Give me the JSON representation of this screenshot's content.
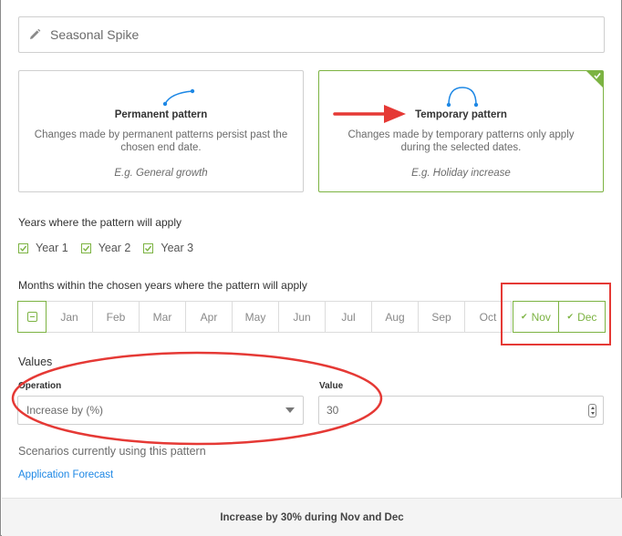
{
  "pattern_name": {
    "value": "Seasonal Spike",
    "icon": "pencil-icon"
  },
  "patterns": [
    {
      "title": "Permanent pattern",
      "description": "Changes made by permanent patterns persist past the chosen end date.",
      "example": "E.g. General growth",
      "selected": false
    },
    {
      "title": "Temporary pattern",
      "description": "Changes made by temporary patterns only apply during the selected dates.",
      "example": "E.g. Holiday increase",
      "selected": true
    }
  ],
  "years": {
    "label": "Years where the pattern will apply",
    "items": [
      {
        "label": "Year 1",
        "checked": true
      },
      {
        "label": "Year 2",
        "checked": true
      },
      {
        "label": "Year 3",
        "checked": true
      }
    ]
  },
  "months": {
    "label": "Months within the chosen years where the pattern will apply",
    "items": [
      {
        "label": "Jan",
        "selected": false
      },
      {
        "label": "Feb",
        "selected": false
      },
      {
        "label": "Mar",
        "selected": false
      },
      {
        "label": "Apr",
        "selected": false
      },
      {
        "label": "May",
        "selected": false
      },
      {
        "label": "Jun",
        "selected": false
      },
      {
        "label": "Jul",
        "selected": false
      },
      {
        "label": "Aug",
        "selected": false
      },
      {
        "label": "Sep",
        "selected": false
      },
      {
        "label": "Oct",
        "selected": false
      },
      {
        "label": "Nov",
        "selected": true
      },
      {
        "label": "Dec",
        "selected": true
      }
    ]
  },
  "values": {
    "title": "Values",
    "operation_label": "Operation",
    "operation_value": "Increase by (%)",
    "value_label": "Value",
    "value": "30"
  },
  "scenarios": {
    "label": "Scenarios currently using this pattern",
    "links": [
      "Application Forecast"
    ]
  },
  "summary": "Increase by 30% during Nov and Dec",
  "colors": {
    "accent_green": "#7cb342",
    "link_blue": "#1e88e5",
    "annotation_red": "#e53935",
    "curve_blue": "#1e88e5"
  }
}
